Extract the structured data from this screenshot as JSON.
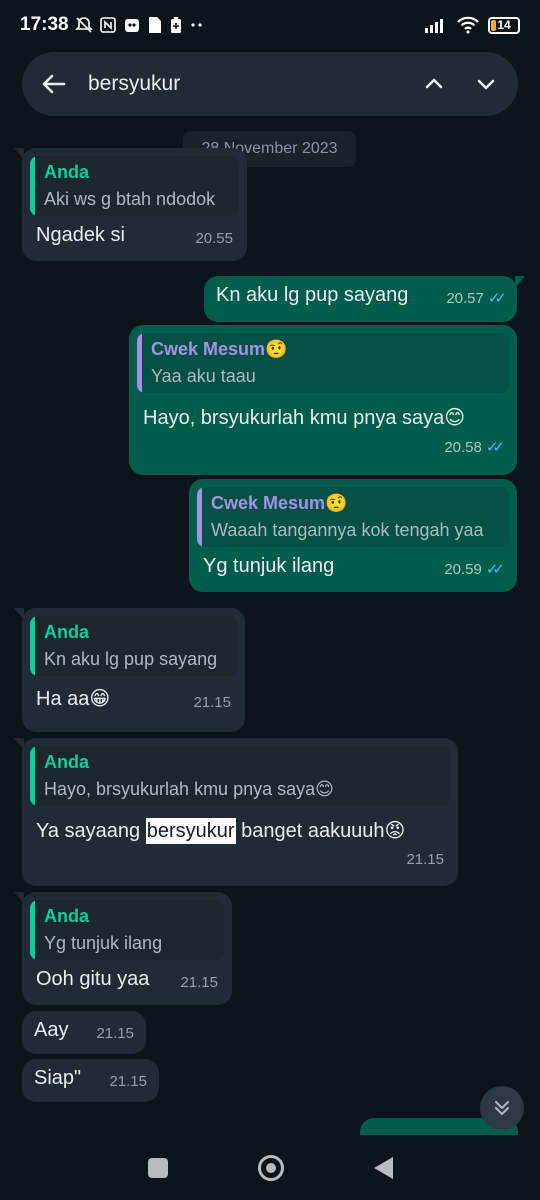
{
  "status_bar": {
    "time": "17:38",
    "battery": "14",
    "icons_left": [
      "mute-notifications-icon",
      "nfc-icon",
      "app-icon",
      "file-icon",
      "battery-saver-icon",
      "more-dots-icon"
    ],
    "icons_right": [
      "signal-icon",
      "wifi-icon",
      "battery-icon"
    ],
    "battery_color": "#f2a93b"
  },
  "search": {
    "query": "bersyukur"
  },
  "chat": {
    "date": "28 November 2023",
    "messages": [
      {
        "dir": "in",
        "quote_author": "Anda",
        "quote_text": "Aki ws g btah ndodok",
        "text": "Ngadek si",
        "time": "20.55"
      },
      {
        "dir": "out",
        "text": "Kn aku lg pup sayang",
        "time": "20.57"
      },
      {
        "dir": "out",
        "quote_author": "Cwek Mesum🤨",
        "quote_text": "Yaa aku taau",
        "text": "Hayo, brsyukurlah kmu pnya saya😊",
        "time": "20.58"
      },
      {
        "dir": "out",
        "quote_author": "Cwek Mesum🤨",
        "quote_text": "Waaah tangannya kok tengah yaa",
        "text": "Yg tunjuk ilang",
        "time": "20.59"
      },
      {
        "dir": "in",
        "quote_author": "Anda",
        "quote_text": "Kn aku lg pup sayang",
        "text": "Ha aa😁",
        "time": "21.15"
      },
      {
        "dir": "in",
        "quote_author": "Anda",
        "quote_text": "Hayo, brsyukurlah kmu pnya saya😊",
        "text_before": "Ya sayaang ",
        "text_match": "bersyukur",
        "text_after": " banget aakuuuh😡",
        "time": "21.15"
      },
      {
        "dir": "in",
        "quote_author": "Anda",
        "quote_text": "Yg tunjuk ilang",
        "text": "Ooh gitu yaa",
        "time": "21.15"
      },
      {
        "dir": "in",
        "text": "Aay",
        "time": "21.15"
      },
      {
        "dir": "in",
        "text": "Siap\"",
        "time": "21.15"
      }
    ]
  },
  "colors": {
    "background": "#0b141a",
    "incoming_bubble": "#1f2c34",
    "outgoing_bubble": "#005c4b",
    "quote_green": "#06cf9c",
    "quote_purple": "#a791e8",
    "read_ticks": "#53bdeb"
  }
}
